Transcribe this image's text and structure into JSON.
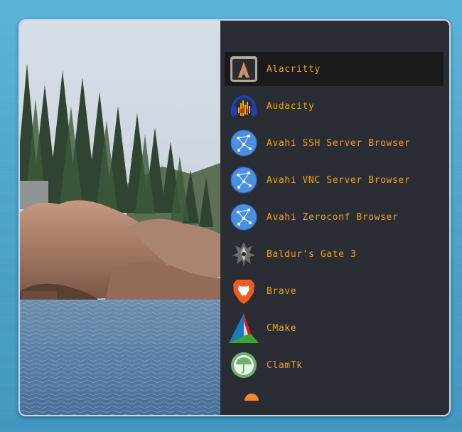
{
  "launcher": {
    "apps": [
      {
        "label": "Alacritty",
        "icon": "alacritty-icon",
        "selected": true
      },
      {
        "label": "Audacity",
        "icon": "audacity-icon",
        "selected": false
      },
      {
        "label": "Avahi SSH Server Browser",
        "icon": "avahi-network-icon",
        "selected": false
      },
      {
        "label": "Avahi VNC Server Browser",
        "icon": "avahi-network-icon",
        "selected": false
      },
      {
        "label": "Avahi Zeroconf Browser",
        "icon": "avahi-network-icon",
        "selected": false
      },
      {
        "label": "Baldur's Gate 3",
        "icon": "baldurs-gate-icon",
        "selected": false
      },
      {
        "label": "Brave",
        "icon": "brave-lion-icon",
        "selected": false
      },
      {
        "label": "CMake",
        "icon": "cmake-icon",
        "selected": false
      },
      {
        "label": "ClamTk",
        "icon": "clamtk-umbrella-icon",
        "selected": false
      }
    ],
    "colors": {
      "label": "#f0a020",
      "panel": "#2b2d34",
      "selected_row": "#1a1a1c",
      "window_border": "#cdd8ea"
    }
  }
}
